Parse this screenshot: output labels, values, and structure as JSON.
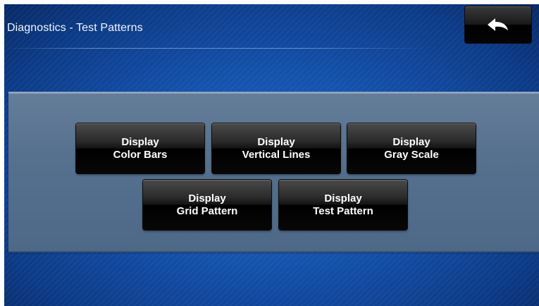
{
  "header": {
    "title": "Diagnostics - Test Patterns",
    "back_icon": "back-arrow-icon"
  },
  "buttons": [
    {
      "line1": "Display",
      "line2": "Color Bars"
    },
    {
      "line1": "Display",
      "line2": "Vertical Lines"
    },
    {
      "line1": "Display",
      "line2": "Gray Scale"
    },
    {
      "line1": "Display",
      "line2": "Grid Pattern"
    },
    {
      "line1": "Display",
      "line2": "Test Pattern"
    }
  ],
  "colors": {
    "background": "#1452ad",
    "panel": "#56708f",
    "button": "#000000",
    "button_text": "#ffffff"
  }
}
